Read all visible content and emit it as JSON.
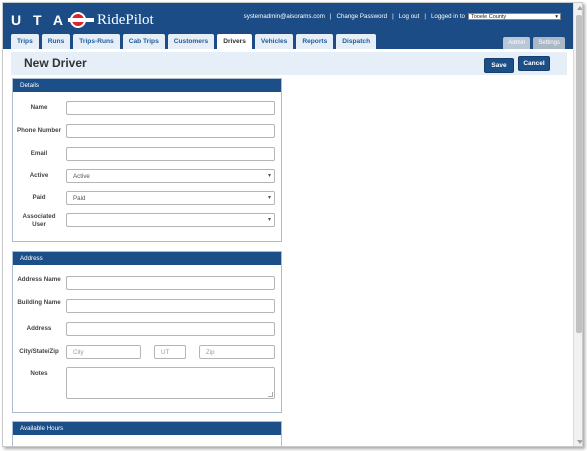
{
  "brand": {
    "uta": "U T A",
    "app_name": "RidePilot"
  },
  "user_bar": {
    "email": "systemadmin@aisorams.com",
    "change_password": "Change Password",
    "logout": "Log out",
    "logged_in_to": "Logged in to",
    "county": "Tooele County"
  },
  "nav": {
    "tabs": [
      "Trips",
      "Runs",
      "Trips-Runs",
      "Cab Trips",
      "Customers",
      "Drivers",
      "Vehicles",
      "Reports",
      "Dispatch"
    ],
    "active": "Drivers",
    "right_tabs": [
      "Admin",
      "Settings"
    ]
  },
  "page": {
    "title": "New Driver",
    "save": "Save",
    "cancel": "Cancel"
  },
  "details": {
    "heading": "Details",
    "name_label": "Name",
    "phone_label": "Phone Number",
    "email_label": "Email",
    "active_label": "Active",
    "active_value": "Active",
    "paid_label": "Paid",
    "paid_value": "Paid",
    "associated_user_label": "Associated User",
    "associated_user_value": ""
  },
  "address": {
    "heading": "Address",
    "address_name_label": "Address Name",
    "building_name_label": "Building Name",
    "address_label": "Address",
    "city_state_zip_label": "City/State/Zip",
    "city_placeholder": "City",
    "state_value": "UT",
    "zip_placeholder": "Zip",
    "notes_label": "Notes"
  },
  "available_hours": {
    "heading": "Available Hours"
  },
  "colors": {
    "header_blue": "#1b4c86",
    "panel_head_blue": "#1c4f88",
    "tab_link_blue": "#1f5d9d",
    "pagehead_bg": "#e6eff8",
    "logo_red": "#d8242c"
  }
}
